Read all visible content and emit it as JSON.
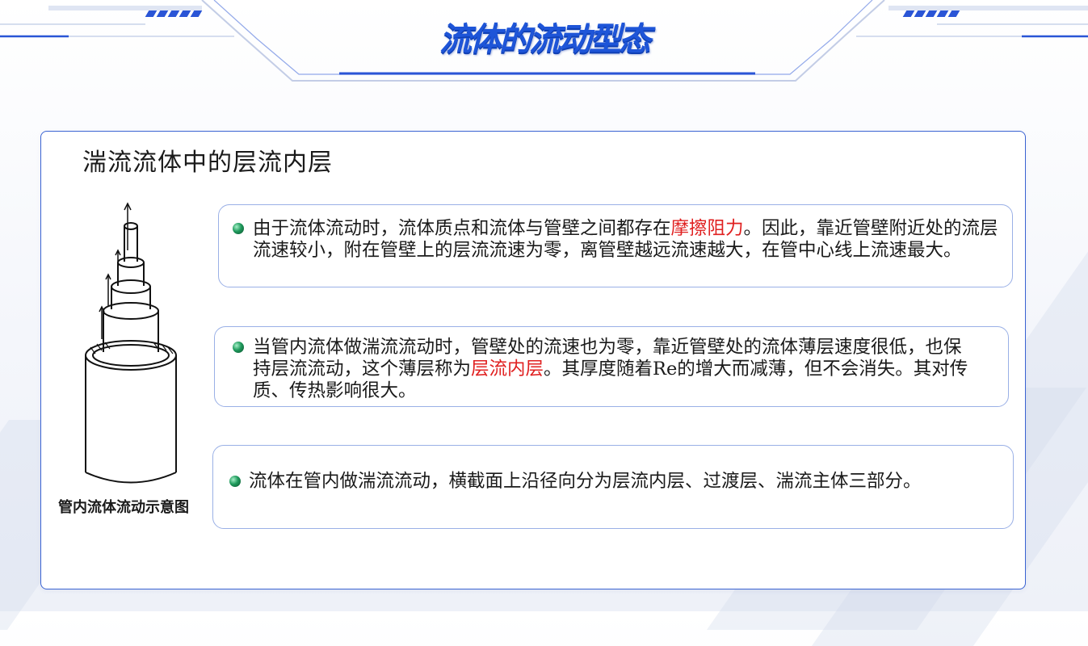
{
  "header": {
    "title": "流体的流动型态"
  },
  "colors": {
    "accent": "#1e55d8",
    "highlight": "#e02020",
    "border": "#3a63d2"
  },
  "panel": {
    "title": "湍流流体中的层流内层"
  },
  "figure": {
    "caption": "管内流体流动示意图"
  },
  "cards": [
    {
      "icon": "green-bullet-icon",
      "pre": " 由于流体流动时，流体质点和流体与管壁之间都存在",
      "highlight": "摩擦阻力",
      "post": "。因此，靠近管壁附近处的流层流速较小，附在管壁上的层流流速为零，离管壁越远流速越大，在管中心线上流速最大。"
    },
    {
      "icon": "green-bullet-icon",
      "pre": "当管内流体做湍流流动时，管壁处的流速也为零，靠近管壁处的流体薄层速度很低，也保持层流流动，这个薄层称为",
      "highlight": "层流内层",
      "post": "。其厚度随着Re的增大而减薄，但不会消失。其对传质、传热影响很大。"
    },
    {
      "icon": "green-bullet-icon",
      "pre": "流体在管内做湍流流动，横截面上沿径向分为层流内层、过渡层、湍流主体三部分。",
      "highlight": "",
      "post": ""
    }
  ]
}
